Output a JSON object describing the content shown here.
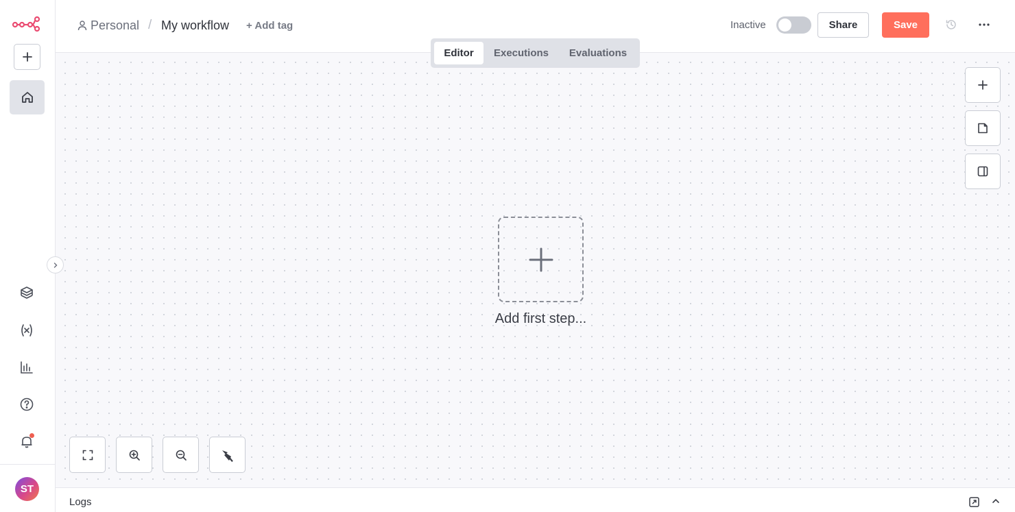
{
  "app": {
    "brand_color": "#ea4b71",
    "accent_color": "#ff6f5c"
  },
  "sidebar": {
    "logo_icon": "n8n-logo-icon",
    "add_icon": "plus-icon",
    "home_icon": "home-icon",
    "collapse_icon": "chevron-right-icon",
    "items": [
      {
        "name": "templates",
        "icon": "cube-stack-icon"
      },
      {
        "name": "variables",
        "icon": "variables-icon"
      },
      {
        "name": "insights",
        "icon": "bar-chart-icon"
      },
      {
        "name": "help",
        "icon": "help-circle-icon"
      },
      {
        "name": "notifications",
        "icon": "bell-icon",
        "has_badge": true
      }
    ],
    "avatar_initials": "ST"
  },
  "header": {
    "breadcrumb": {
      "project": "Personal",
      "separator": "/",
      "workflow_name": "My workflow"
    },
    "add_tag_label": "+ Add tag",
    "status_label": "Inactive",
    "active": false,
    "share_label": "Share",
    "save_label": "Save"
  },
  "tabs": [
    {
      "label": "Editor",
      "active": true
    },
    {
      "label": "Executions",
      "active": false
    },
    {
      "label": "Evaluations",
      "active": false
    }
  ],
  "canvas": {
    "first_step_label": "Add first step...",
    "right_tools": [
      "plus-icon",
      "sticky-note-icon",
      "panel-icon"
    ],
    "bottom_tools": [
      "fit-view-icon",
      "zoom-in-icon",
      "zoom-out-icon",
      "tidy-up-icon"
    ]
  },
  "logs": {
    "label": "Logs"
  }
}
